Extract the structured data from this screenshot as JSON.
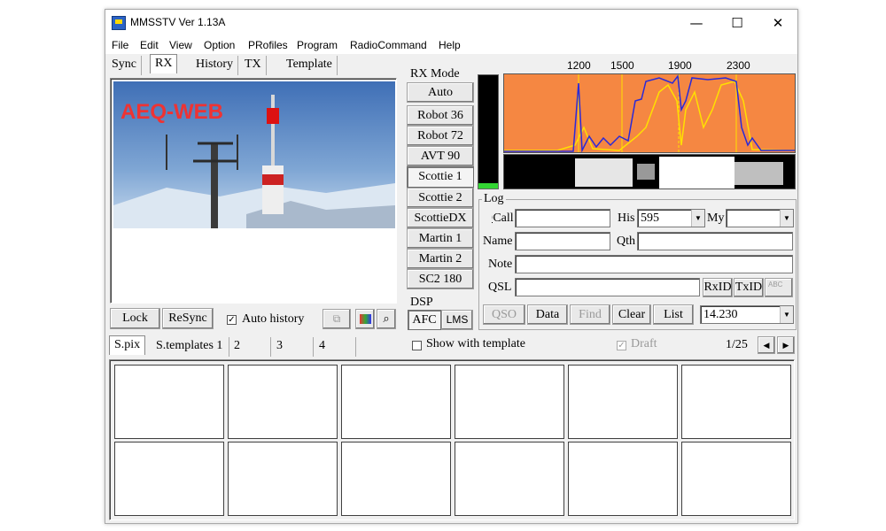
{
  "window": {
    "title": "MMSSTV Ver 1.13A",
    "minimize": "—",
    "maximize": "☐",
    "close": "✕"
  },
  "menu": [
    "File",
    "Edit",
    "View",
    "Option",
    "PRofiles",
    "Program",
    "RadioCommand",
    "Help"
  ],
  "top_tabs": [
    "Sync",
    "RX",
    "History",
    "TX",
    "Template"
  ],
  "image_text": "AEQ-WEB",
  "rx_controls": {
    "lock": "Lock",
    "resync": "ReSync",
    "auto_history": "Auto history",
    "auto_history_checked": true
  },
  "rx_mode": {
    "label": "RX Mode",
    "modes": [
      "Auto",
      "Robot 36",
      "Robot 72",
      "AVT 90",
      "Scottie 1",
      "Scottie 2",
      "ScottieDX",
      "Martin 1",
      "Martin 2",
      "SC2 180"
    ],
    "selected": "Scottie 1"
  },
  "dsp": {
    "label": "DSP",
    "afc": "AFC",
    "lms": "LMS"
  },
  "spectrum": {
    "freq_labels": [
      "1200",
      "1500",
      "1900",
      "2300"
    ],
    "bg_color": "#f58742"
  },
  "log": {
    "label": "Log",
    "call_label": "Call",
    "call_value": "",
    "his_label": "His",
    "his_value": "595",
    "my_label": "My",
    "my_value": "",
    "name_label": "Name",
    "name_value": "",
    "qth_label": "Qth",
    "qth_value": "",
    "note_label": "Note",
    "note_value": "",
    "qsl_label": "QSL",
    "qsl_value": "",
    "rxid": "RxID",
    "txid": "TxID",
    "abc": "ABC"
  },
  "log_buttons": {
    "qso": "QSO",
    "data": "Data",
    "find": "Find",
    "clear": "Clear",
    "list": "List",
    "freq": "14.230"
  },
  "bottom_tabs": [
    "S.pix",
    "S.templates 1",
    "2",
    "3",
    "4"
  ],
  "show_with_template": "Show with template",
  "draft": "Draft",
  "page_indicator": "1/25",
  "prev_arrow": "◀",
  "next_arrow": "▶"
}
